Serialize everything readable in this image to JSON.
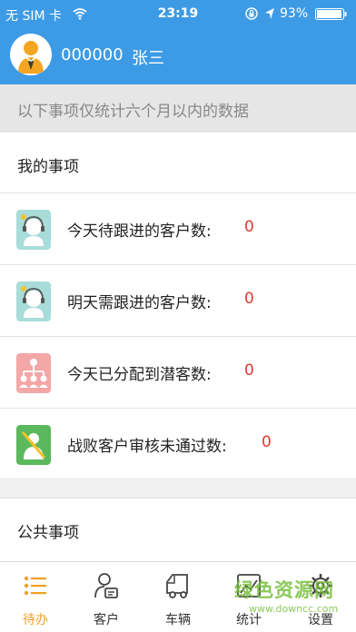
{
  "status_bar": {
    "carrier": "无 SIM 卡",
    "time": "23:19",
    "battery": "93%"
  },
  "header": {
    "user_id": "000000",
    "user_name": "张三"
  },
  "notice": "以下事项仅统计六个月以内的数据",
  "my_items": {
    "title": "我的事项",
    "rows": [
      {
        "label": "今天待跟进的客户数:",
        "count": "0",
        "icon": "customer-service-icon"
      },
      {
        "label": "明天需跟进的客户数:",
        "count": "0",
        "icon": "customer-service-icon"
      },
      {
        "label": "今天已分配到潜客数:",
        "count": "0",
        "icon": "org-chart-icon"
      },
      {
        "label": "战败客户审核未通过数:",
        "count": "0",
        "icon": "rejected-user-icon"
      }
    ]
  },
  "public_items": {
    "title": "公共事项"
  },
  "tabs": [
    {
      "label": "待办",
      "icon": "list-icon",
      "active": true
    },
    {
      "label": "客户",
      "icon": "customer-icon",
      "active": false
    },
    {
      "label": "车辆",
      "icon": "truck-icon",
      "active": false
    },
    {
      "label": "统计",
      "icon": "statistics-icon",
      "active": false
    },
    {
      "label": "设置",
      "icon": "gear-icon",
      "active": false
    }
  ],
  "watermark": {
    "main": "绿色资源网",
    "sub": "www.downcc.com"
  },
  "colors": {
    "header_blue": "#3d9be6",
    "count_red": "#e03a2f",
    "active_tab": "#f0a020"
  }
}
